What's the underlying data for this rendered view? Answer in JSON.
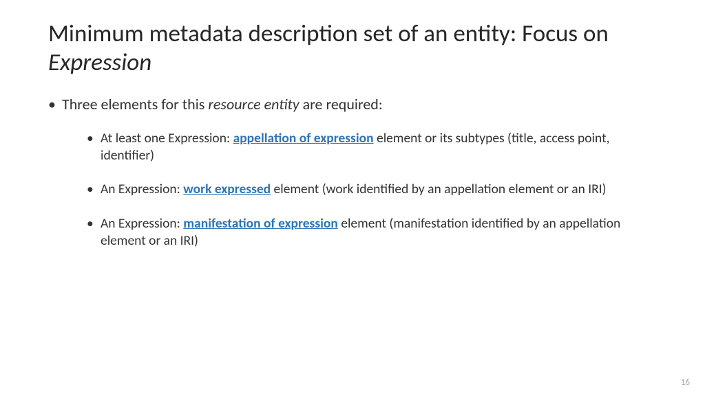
{
  "title": {
    "part1": "Minimum metadata description set of an entity: Focus on ",
    "italic": "Expression"
  },
  "mainBullet": {
    "part1": "Three elements for this ",
    "italic": "resource entity",
    "part2": " are required:"
  },
  "sub": [
    {
      "pre": "At least one Expression: ",
      "link": "appellation of expression",
      "post": " element or its subtypes (title, access point, identifier)"
    },
    {
      "pre": "An Expression: ",
      "link": "work expressed",
      "post": " element (work identified by an appellation element or an IRI)"
    },
    {
      "pre": "An Expression: ",
      "link": "manifestation of expression",
      "post": " element (manifestation identified by an appellation element or an IRI)"
    }
  ],
  "pageNumber": "16"
}
